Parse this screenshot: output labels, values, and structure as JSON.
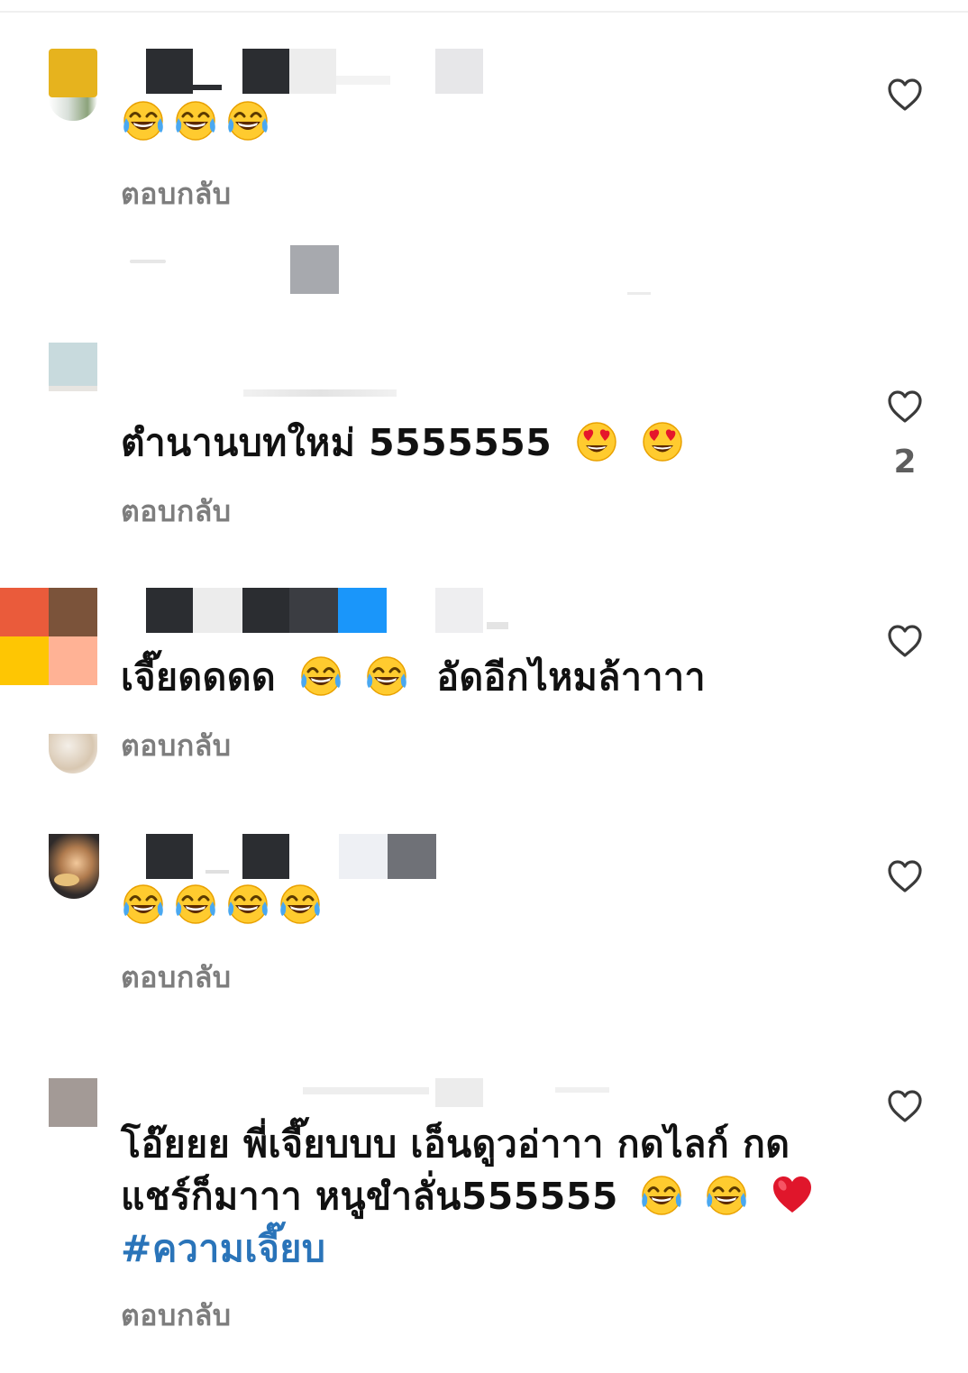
{
  "comments": [
    {
      "text": "",
      "emoji": [
        "face-with-tears-of-joy",
        "face-with-tears-of-joy",
        "face-with-tears-of-joy"
      ],
      "reply": "ตอบกลับ"
    },
    {
      "text_main": "ตำนานบทใหม่ 5555555",
      "emoji": [
        "smiling-face-with-heart-eyes",
        "smiling-face-with-heart-eyes"
      ],
      "reply": "ตอบกลับ",
      "likes": "2"
    },
    {
      "text_a": "เจี๊ยดดดด",
      "text_b": "อัดอีกไหมล้าาาา",
      "reply": "ตอบกลับ"
    },
    {
      "emoji": [
        "face-with-tears-of-joy",
        "face-with-tears-of-joy",
        "face-with-tears-of-joy",
        "face-with-tears-of-joy"
      ],
      "reply": "ตอบกลับ"
    },
    {
      "line1": "โอ๊ยยย พี่เจี๊ยบบบ เอ็นดูวอ่าาา กดไลก์ กด",
      "line2": "แชร์ก็มาาา หนูขำลั่น555555",
      "hashtag": "#ความเจี๊ยบ",
      "reply": "ตอบกลับ"
    }
  ],
  "icons": {
    "like": "heart-outline-icon",
    "laugh": "face-with-tears-of-joy",
    "love": "smiling-face-with-heart-eyes",
    "heart": "red-heart"
  },
  "colors": {
    "text": "#111111",
    "reply": "#7d7d7d",
    "hashtag": "#2a74b9",
    "like_outline": "#3a3a3a",
    "heart": "#e0162b"
  }
}
